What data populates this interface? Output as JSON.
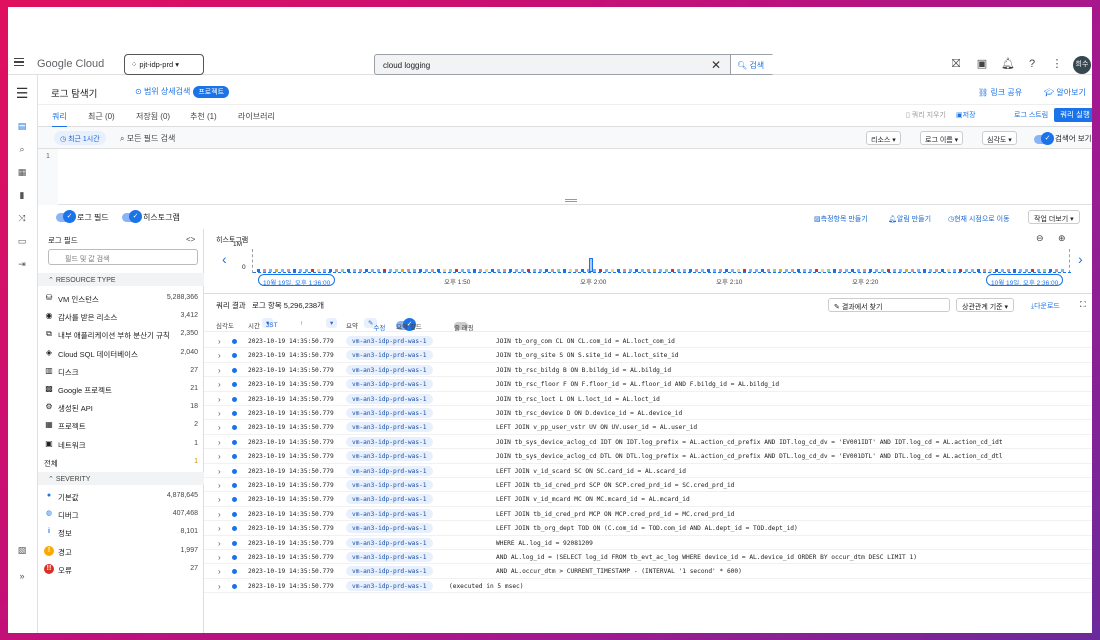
{
  "topbar": {
    "logo": "Google Cloud",
    "project": "pjt-idp-prd",
    "search_value": "cloud logging",
    "search_button": "검색",
    "avatar": "희수"
  },
  "header": {
    "title": "로그 탐색기",
    "scope": "범위 상세검색",
    "scope_chip": "프로젝트",
    "share": "링크 공유",
    "learn": "알아보기"
  },
  "tabs": {
    "items": [
      "쿼리",
      "최근 (0)",
      "저장됨 (0)",
      "추천 (1)",
      "라이브러리"
    ],
    "clear": "쿼리 지우기",
    "save": "저장",
    "stream": "로그 스트림",
    "run": "쿼리 실행"
  },
  "querybar": {
    "time": "최근 1시간",
    "field_search": "모든 필드 검색",
    "resource": "리소스",
    "logname": "로그 이름",
    "severity": "심각도",
    "show_query": "검색어 보기"
  },
  "editor": {
    "line": "1"
  },
  "toggles": {
    "log_fields": "로그 필드",
    "histogram": "히스토그램",
    "create_metric": "측정항목 만들기",
    "create_alert": "알림 만들기",
    "jump_now": "현재 시점으로 이동",
    "more_actions": "작업 더보기"
  },
  "fields": {
    "title": "로그 필드",
    "search_placeholder": "필드 및 값 검색",
    "resource_section": "RESOURCE TYPE",
    "resources": [
      {
        "name": "VM 인스턴스",
        "count": "5,288,366",
        "icon": "vm-icon"
      },
      {
        "name": "감사를 받은 리소스",
        "count": "3,412",
        "icon": "audit-icon"
      },
      {
        "name": "내부 애플리케이션 부하 분산기 규칙",
        "count": "2,350",
        "icon": "lb-icon"
      },
      {
        "name": "Cloud SQL 데이터베이스",
        "count": "2,040",
        "icon": "sql-icon"
      },
      {
        "name": "디스크",
        "count": "27",
        "icon": "disk-icon"
      },
      {
        "name": "Google 프로젝트",
        "count": "21",
        "icon": "project-icon"
      },
      {
        "name": "생성된 API",
        "count": "18",
        "icon": "api-icon"
      },
      {
        "name": "프로젝트",
        "count": "2",
        "icon": "grid-icon"
      },
      {
        "name": "네트워크",
        "count": "1",
        "icon": "network-icon"
      }
    ],
    "total_label": "전체",
    "total_count": "1",
    "severity_section": "SEVERITY",
    "severities": [
      {
        "name": "기본값",
        "count": "4,878,645",
        "color": "#1a73e8"
      },
      {
        "name": "디버그",
        "count": "407,468",
        "color": "#1a73e8"
      },
      {
        "name": "정보",
        "count": "8,101",
        "color": "#1a73e8"
      },
      {
        "name": "경고",
        "count": "1,997",
        "color": "#f9ab00"
      },
      {
        "name": "오류",
        "count": "27",
        "color": "#d93025"
      }
    ]
  },
  "histogram": {
    "title": "히스토그램",
    "ymax": "1M",
    "ymin": "0",
    "start": "10월 19일, 오후 1:36:00",
    "end": "10월 19일, 오후 2:36:00",
    "ticks": [
      "오후 1:50",
      "오후 2:00",
      "오후 2:10",
      "오후 2:20",
      "오후 2:30"
    ]
  },
  "results": {
    "title": "쿼리 결과",
    "count": "로그 항목 5,296,238개",
    "find": "결과에서 찾기",
    "sort": "상관관계 기준",
    "download": "다운로드",
    "col_severity": "심각도",
    "col_time": "시간",
    "tz": "JST",
    "col_summary": "요약",
    "edit": "수정",
    "summary_fields": "요약 필드",
    "wrap": "줄 래핑",
    "rows": [
      {
        "ts": "2023-10-19 14:35:50.779",
        "pod": "vm-an3-idp-prd-was-1",
        "msg": "JOIN tb_org_com CL ON CL.com_id = AL.loct_com_id"
      },
      {
        "ts": "2023-10-19 14:35:50.779",
        "pod": "vm-an3-idp-prd-was-1",
        "msg": "JOIN tb_org_site S ON S.site_id = AL.loct_site_id"
      },
      {
        "ts": "2023-10-19 14:35:50.779",
        "pod": "vm-an3-idp-prd-was-1",
        "msg": "JOIN tb_rsc_bildg B ON B.bildg_id = AL.bildg_id"
      },
      {
        "ts": "2023-10-19 14:35:50.779",
        "pod": "vm-an3-idp-prd-was-1",
        "msg": "JOIN tb_rsc_floor F ON F.floor_id = AL.floor_id AND F.bildg_id = AL.bildg_id"
      },
      {
        "ts": "2023-10-19 14:35:50.779",
        "pod": "vm-an3-idp-prd-was-1",
        "msg": "JOIN tb_rsc_loct L ON L.loct_id = AL.loct_id"
      },
      {
        "ts": "2023-10-19 14:35:50.779",
        "pod": "vm-an3-idp-prd-was-1",
        "msg": "JOIN tb_rsc_device D ON D.device_id = AL.device_id"
      },
      {
        "ts": "2023-10-19 14:35:50.779",
        "pod": "vm-an3-idp-prd-was-1",
        "msg": "LEFT JOIN v_pp_user_vstr UV ON UV.user_id = AL.user_id"
      },
      {
        "ts": "2023-10-19 14:35:50.779",
        "pod": "vm-an3-idp-prd-was-1",
        "msg": "JOIN tb_sys_device_aclog_cd IDT ON IDT.log_prefix = AL.action_cd_prefix AND IDT.log_cd_dv = 'EV001IDT' AND IDT.log_cd = AL.action_cd_idt"
      },
      {
        "ts": "2023-10-19 14:35:50.779",
        "pod": "vm-an3-idp-prd-was-1",
        "msg": "JOIN tb_sys_device_aclog_cd DTL ON DTL.log_prefix = AL.action_cd_prefix AND DTL.log_cd_dv = 'EV001DTL' AND DTL.log_cd = AL.action_cd_dtl"
      },
      {
        "ts": "2023-10-19 14:35:50.779",
        "pod": "vm-an3-idp-prd-was-1",
        "msg": "LEFT JOIN v_id_scard SC ON SC.card_id = AL.scard_id"
      },
      {
        "ts": "2023-10-19 14:35:50.779",
        "pod": "vm-an3-idp-prd-was-1",
        "msg": "LEFT JOIN tb_id_cred_prd SCP ON SCP.cred_prd_id = SC.cred_prd_id"
      },
      {
        "ts": "2023-10-19 14:35:50.779",
        "pod": "vm-an3-idp-prd-was-1",
        "msg": "LEFT JOIN v_id_mcard MC ON MC.mcard_id = AL.mcard_id"
      },
      {
        "ts": "2023-10-19 14:35:50.779",
        "pod": "vm-an3-idp-prd-was-1",
        "msg": "LEFT JOIN tb_id_cred_prd MCP ON MCP.cred_prd_id = MC.cred_prd_id"
      },
      {
        "ts": "2023-10-19 14:35:50.779",
        "pod": "vm-an3-idp-prd-was-1",
        "msg": "LEFT JOIN tb_org_dept TOD ON (C.com_id = TOD.com_id AND AL.dept_id = TOD.dept_id)"
      },
      {
        "ts": "2023-10-19 14:35:50.779",
        "pod": "vm-an3-idp-prd-was-1",
        "msg": "WHERE AL.log_id = 92081209"
      },
      {
        "ts": "2023-10-19 14:35:50.779",
        "pod": "vm-an3-idp-prd-was-1",
        "msg": "AND AL.log_id = (SELECT log_id FROM tb_evt_ac_log WHERE device_id = AL.device_id ORDER BY occur_dtm DESC LIMIT 1)"
      },
      {
        "ts": "2023-10-19 14:35:50.779",
        "pod": "vm-an3-idp-prd-was-1",
        "msg": "AND AL.occur_dtm > CURRENT_TIMESTAMP - (INTERVAL '1 second' * 600)"
      },
      {
        "ts": "2023-10-19 14:35:50.779",
        "pod": "vm-an3-idp-prd-was-1",
        "msg": "(executed in 5 msec)",
        "short": true
      }
    ]
  }
}
